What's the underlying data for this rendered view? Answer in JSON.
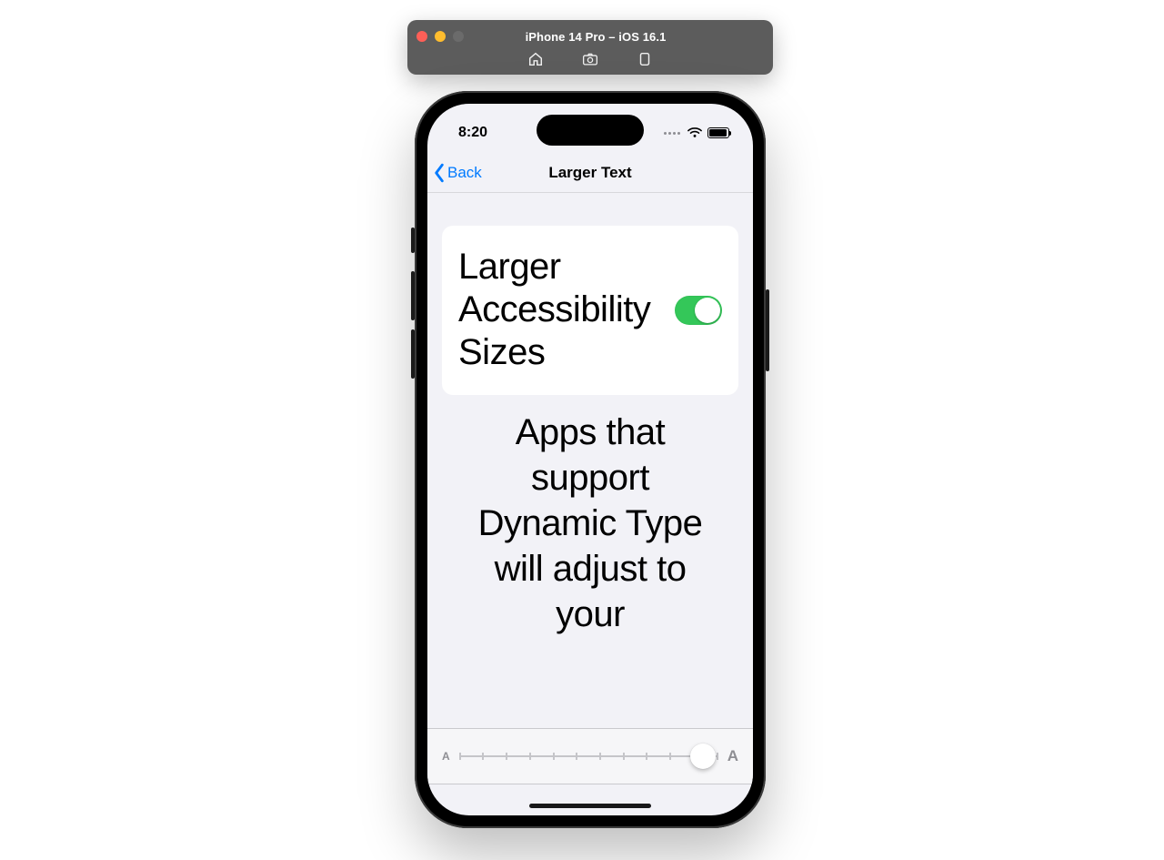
{
  "simulator": {
    "title": "iPhone 14 Pro – iOS 16.1",
    "icons": {
      "home": "home-icon",
      "screenshot": "screenshot-icon",
      "rotate": "rotate-icon"
    }
  },
  "statusbar": {
    "time": "8:20"
  },
  "navbar": {
    "back_label": "Back",
    "title": "Larger Text"
  },
  "settings": {
    "larger_accessibility_sizes": {
      "label": "Larger Accessi­bility Sizes",
      "enabled": true
    },
    "footer": "Apps that support Dynamic Type will adjust to your"
  },
  "text_size_slider": {
    "small_glyph": "A",
    "large_glyph": "A",
    "steps": 12,
    "value": 11,
    "knob_position_pct": 94
  },
  "colors": {
    "ios_blue": "#007aff",
    "ios_green": "#34c759",
    "panel_bg": "#f2f2f7"
  }
}
